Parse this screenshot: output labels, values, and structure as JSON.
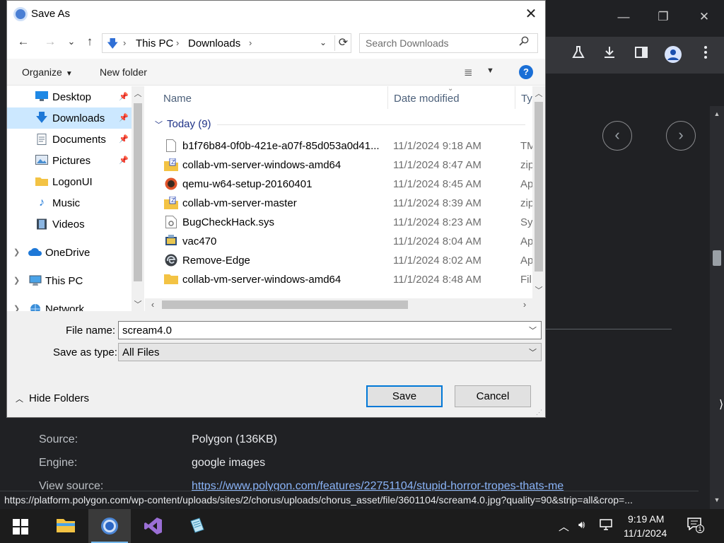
{
  "dialog": {
    "title": "Save As",
    "close_glyph": "✕",
    "nav": {
      "back": "←",
      "forward": "→",
      "history": "⌄",
      "up": "↑"
    },
    "address": {
      "crumbs": [
        "This PC",
        "Downloads"
      ],
      "separator": "›",
      "dropdown": "⌄",
      "refresh": "⟳"
    },
    "search": {
      "placeholder": "Search Downloads",
      "icon": "search-icon"
    },
    "command_bar": {
      "organize": "Organize",
      "new_folder": "New folder",
      "view_icon": "≣",
      "help": "?"
    },
    "nav_pane": {
      "items": [
        {
          "label": "Desktop",
          "icon": "desktop-icon",
          "pinned": true
        },
        {
          "label": "Downloads",
          "icon": "downloads-icon",
          "pinned": true,
          "selected": true
        },
        {
          "label": "Documents",
          "icon": "documents-icon",
          "pinned": true
        },
        {
          "label": "Pictures",
          "icon": "pictures-icon",
          "pinned": true
        },
        {
          "label": "LogonUI",
          "icon": "folder-icon"
        },
        {
          "label": "Music",
          "icon": "music-icon"
        },
        {
          "label": "Videos",
          "icon": "videos-icon"
        },
        {
          "label": "OneDrive",
          "icon": "onedrive-icon",
          "expandable": true
        },
        {
          "label": "This PC",
          "icon": "this-pc-icon",
          "expandable": true
        },
        {
          "label": "Network",
          "icon": "network-icon",
          "expandable": true
        }
      ]
    },
    "file_list": {
      "columns": [
        "Name",
        "Date modified",
        "Ty"
      ],
      "group": {
        "label": "Today (9)"
      },
      "rows": [
        {
          "name": "b1f76b84-0f0b-421e-a07f-85d053a0d41...",
          "date": "11/1/2024 9:18 AM",
          "type": "TM",
          "icon": "file-icon"
        },
        {
          "name": "collab-vm-server-windows-amd64",
          "date": "11/1/2024 8:47 AM",
          "type": "zip",
          "icon": "zip-folder-icon"
        },
        {
          "name": "qemu-w64-setup-20160401",
          "date": "11/1/2024 8:45 AM",
          "type": "Ap",
          "icon": "qemu-app-icon"
        },
        {
          "name": "collab-vm-server-master",
          "date": "11/1/2024 8:39 AM",
          "type": "zip",
          "icon": "zip-folder-icon"
        },
        {
          "name": "BugCheckHack.sys",
          "date": "11/1/2024 8:23 AM",
          "type": "Sy",
          "icon": "system-file-icon"
        },
        {
          "name": "vac470",
          "date": "11/1/2024 8:04 AM",
          "type": "Ap",
          "icon": "installer-icon"
        },
        {
          "name": "Remove-Edge",
          "date": "11/1/2024 8:02 AM",
          "type": "Ap",
          "icon": "edge-app-icon"
        },
        {
          "name": "collab-vm-server-windows-amd64",
          "date": "11/1/2024 8:48 AM",
          "type": "Fil",
          "icon": "folder-icon"
        }
      ]
    },
    "file_name_label": "File name:",
    "file_name_value": "scream4.0",
    "save_type_label": "Save as type:",
    "save_type_value": "All Files",
    "hide_folders": "Hide Folders",
    "save_button": "Save",
    "cancel_button": "Cancel"
  },
  "browser": {
    "window_controls": {
      "minimize": "—",
      "restore": "❐",
      "close": "✕"
    },
    "toolbar_icons": [
      "labs-icon",
      "download-icon",
      "side-panel-icon",
      "profile-icon",
      "menu-icon"
    ],
    "details": {
      "source_label": "Source:",
      "source_value": "Polygon (136KB)",
      "engine_label": "Engine:",
      "engine_value": "google images",
      "view_source_label": "View source:",
      "view_source_link": "https://www.polygon.com/features/22751104/stupid-horror-tropes-thats-me"
    },
    "status_url": "https://platform.polygon.com/wp-content/uploads/sites/2/chorus/uploads/chorus_asset/file/3601104/scream4.0.jpg?quality=90&strip=all&crop=..."
  },
  "taskbar": {
    "apps": [
      {
        "name": "file-explorer",
        "icon": "file-explorer-icon"
      },
      {
        "name": "chrome",
        "icon": "chrome-icon",
        "active": true
      },
      {
        "name": "visual-studio",
        "icon": "visual-studio-icon"
      },
      {
        "name": "notepad",
        "icon": "notepad-icon"
      }
    ],
    "time": "9:19 AM",
    "date": "11/1/2024",
    "notification_count": "1"
  }
}
